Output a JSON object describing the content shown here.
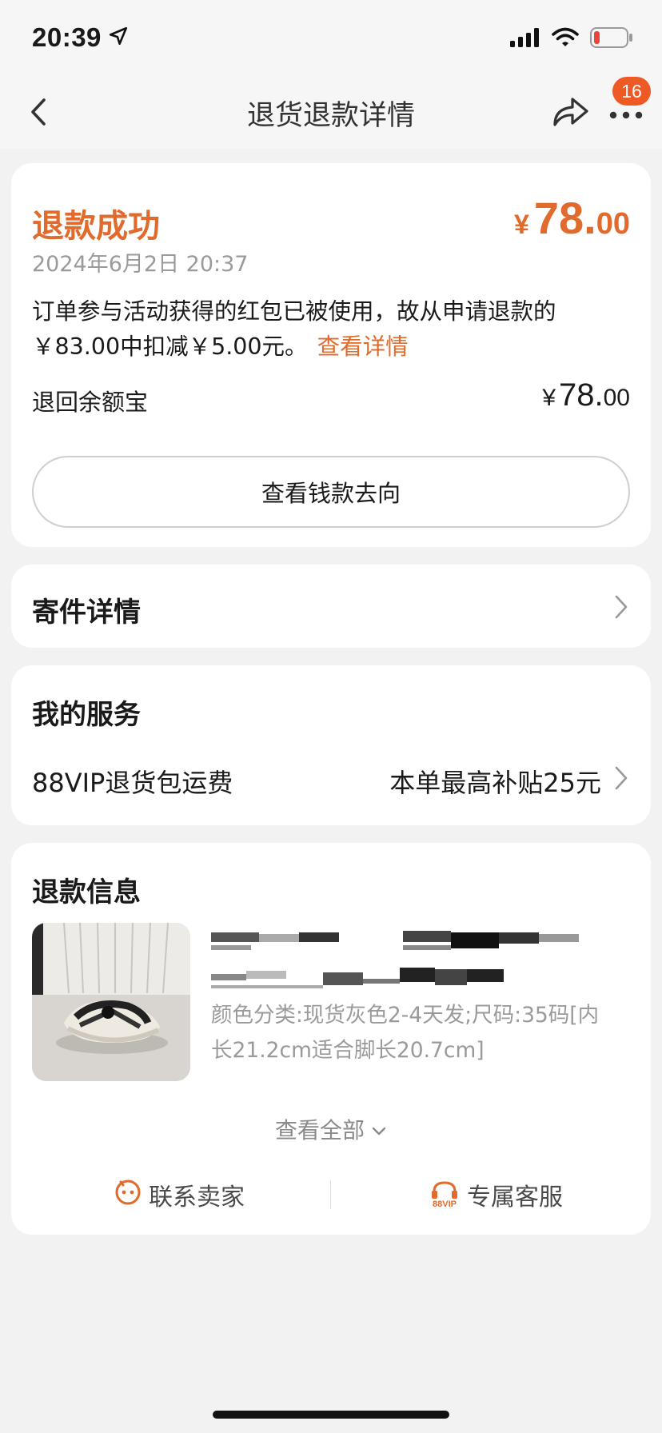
{
  "status_bar": {
    "time": "20:39",
    "icons": [
      "location-arrow-icon",
      "cellular-signal-icon",
      "wifi-icon",
      "battery-low-icon"
    ]
  },
  "nav": {
    "title": "退货退款详情",
    "badge_count": "16",
    "icons": [
      "back-chevron-icon",
      "share-icon",
      "more-dots-icon"
    ]
  },
  "refund": {
    "status": "退款成功",
    "amount_currency": "¥",
    "amount_int": "78.",
    "amount_dec": "00",
    "date": "2024年6月2日 20:37",
    "note_line1": "订单参与活动获得的红包已被使用，故从申请退款的",
    "note_line2": "￥83.00中扣减￥5.00元。",
    "note_link": "查看详情",
    "destination": "退回余额宝",
    "dest_currency": "¥",
    "dest_int": "78.",
    "dest_dec": "00",
    "money_flow_button": "查看钱款去向"
  },
  "shipping": {
    "title": "寄件详情"
  },
  "service": {
    "title": "我的服务",
    "name": "88VIP退货包运费",
    "value": "本单最高补贴25元"
  },
  "refund_info": {
    "title": "退款信息",
    "product_spec": "颜色分类:现货灰色2-4天发;尺码:35码[内长21.2cm适合脚长20.7cm]",
    "view_all": "查看全部",
    "contact_seller": "联系卖家",
    "exclusive_service": "专属客服",
    "vip_label": "88VIP"
  },
  "colors": {
    "accent": "#e16a2d",
    "badge": "#ee5a24",
    "muted_text": "#9a9a9a",
    "background": "#f2f2f2"
  }
}
